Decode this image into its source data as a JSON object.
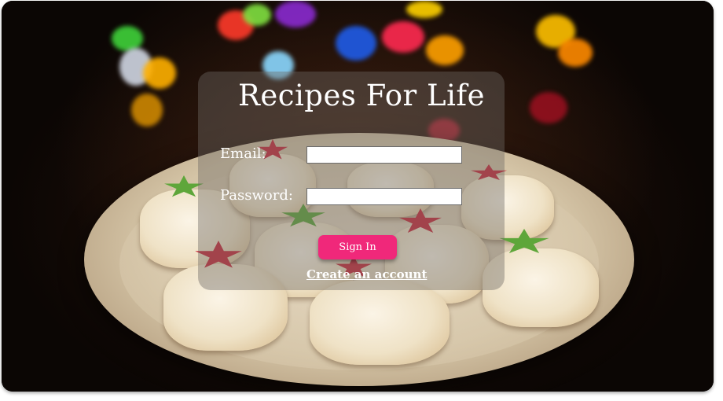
{
  "app": {
    "title": "Recipes For Life"
  },
  "form": {
    "email_label": "Email:",
    "email_value": "",
    "password_label": "Password:",
    "password_value": "",
    "signin_label": "Sign In",
    "create_account_label": "Create an account"
  },
  "colors": {
    "accent": "#f0287a",
    "card_overlay": "rgba(110,105,100,0.42)"
  }
}
